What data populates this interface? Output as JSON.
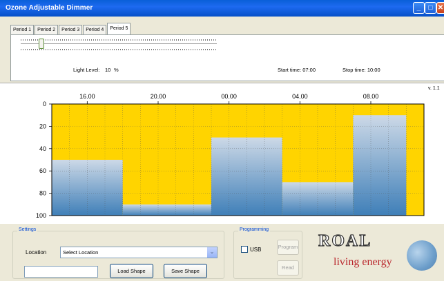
{
  "window": {
    "title": "Ozone Adjustable Dimmer"
  },
  "tabs": [
    "Period 1",
    "Period 2",
    "Period 3",
    "Period 4",
    "Period 5"
  ],
  "active_tab": "Period 5",
  "period": {
    "light_level_label": "Light Level:",
    "light_level_value": "10",
    "light_level_unit": "%",
    "slider_value_percent": 10,
    "start_label": "Start time: 07:00",
    "stop_label": "Stop time: 10:00"
  },
  "version": "v. 1.1",
  "chart_data": {
    "type": "area",
    "x_ticks": [
      "16.00",
      "20.00",
      "00.00",
      "04.00",
      "08.00"
    ],
    "y_ticks": [
      "0",
      "20",
      "40",
      "60",
      "80",
      "100"
    ],
    "ylim": [
      0,
      100
    ],
    "y_inverted": true,
    "segments": [
      {
        "start": "14:00",
        "end": "18:00",
        "value": 50
      },
      {
        "start": "18:00",
        "end": "23:00",
        "value": 90
      },
      {
        "start": "23:00",
        "end": "03:00",
        "value": 30
      },
      {
        "start": "03:00",
        "end": "07:00",
        "value": 70
      },
      {
        "start": "07:00",
        "end": "10:00",
        "value": 10
      }
    ],
    "colors": {
      "background": "#ffd400",
      "fill_top": "#c9d6e6",
      "fill_bottom": "#3f7fb8"
    }
  },
  "settings": {
    "title": "Settings",
    "location_label": "Location",
    "location_value": "Select Location",
    "load_label": "Load Shape",
    "save_label": "Save Shape"
  },
  "programming": {
    "title": "Programming",
    "usb_label": "USB",
    "program_label": "Program",
    "read_label": "Read"
  },
  "logo": {
    "roal": "ROAL",
    "tagline": "living energy"
  }
}
